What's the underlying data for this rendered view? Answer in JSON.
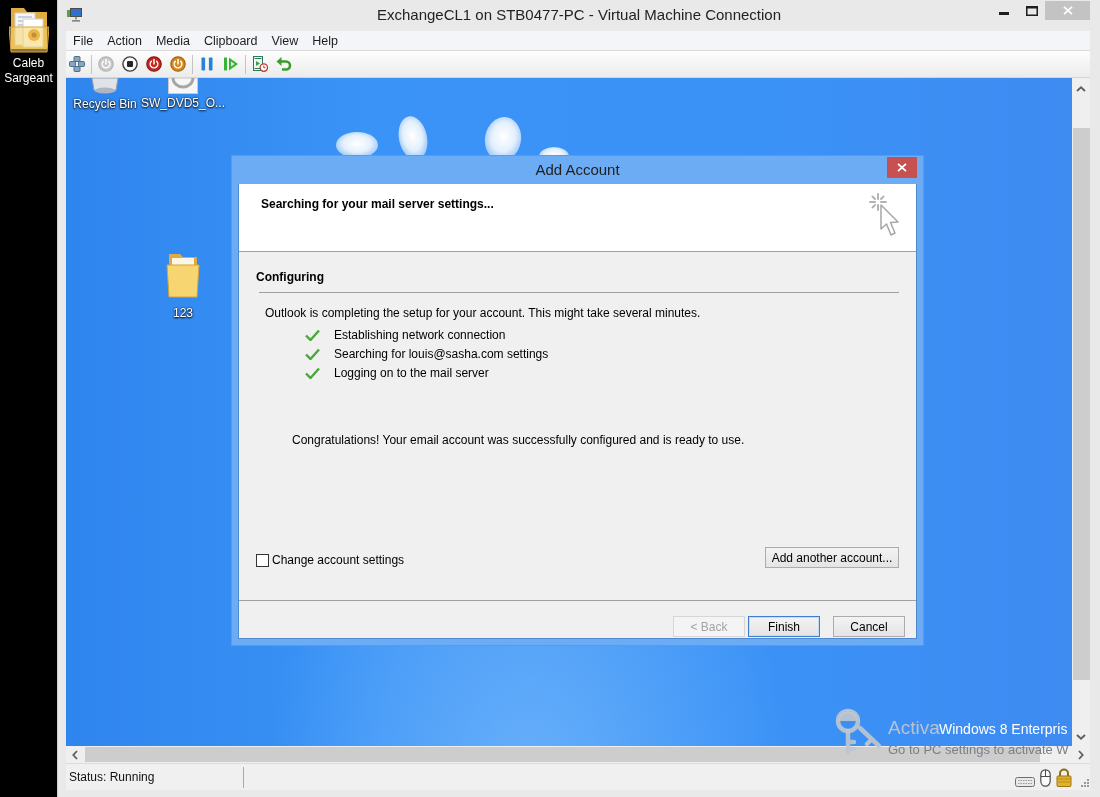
{
  "host_desktop": {
    "icons": [
      {
        "label": "Caleb Sargeant",
        "kind": "folder"
      }
    ]
  },
  "window": {
    "title": "ExchangeCL1 on STB0477-PC - Virtual Machine Connection"
  },
  "menu": [
    "File",
    "Action",
    "Media",
    "Clipboard",
    "View",
    "Help"
  ],
  "toolbar": {
    "groups": [
      [
        {
          "kind": "keys",
          "disabled": false
        }
      ],
      [
        {
          "kind": "start",
          "disabled": true
        },
        {
          "kind": "stop",
          "disabled": false
        },
        {
          "kind": "shutdown",
          "disabled": false
        },
        {
          "kind": "save",
          "disabled": false
        }
      ],
      [
        {
          "kind": "pause",
          "disabled": false
        },
        {
          "kind": "resume",
          "disabled": false
        }
      ],
      [
        {
          "kind": "checkpoint",
          "disabled": false
        },
        {
          "kind": "revert",
          "disabled": false
        }
      ]
    ]
  },
  "vm_desktop": {
    "icons": [
      {
        "label": "Recycle Bin",
        "kind": "bin"
      },
      {
        "label": "SW_DVD5_O...",
        "kind": "disc"
      },
      {
        "label": "123",
        "kind": "folder"
      }
    ],
    "edition_text": "Windows 8 Enterpris"
  },
  "dialog": {
    "title": "Add Account",
    "header": "Searching for your mail server settings...",
    "section": "Configuring",
    "intro": "Outlook is completing the setup for your account. This might take several minutes.",
    "steps": [
      {
        "label": "Establishing network connection",
        "done": true
      },
      {
        "label": "Searching for louis@sasha.com settings",
        "done": true
      },
      {
        "label": "Logging on to the mail server",
        "done": true
      }
    ],
    "message": "Congratulations! Your email account was successfully configured and is ready to use.",
    "change_settings": {
      "label": "Change account settings",
      "checked": false
    },
    "add_another": "Add another account...",
    "buttons": [
      {
        "label": "< Back",
        "disabled": true,
        "default": false
      },
      {
        "label": "Finish",
        "disabled": false,
        "default": true
      },
      {
        "label": "Cancel",
        "disabled": false,
        "default": false
      }
    ]
  },
  "activation_notice": {
    "line_1": "Activa",
    "line_2": "Go to PC settings to activate W"
  },
  "status_bar": {
    "status": "Status: Running"
  }
}
